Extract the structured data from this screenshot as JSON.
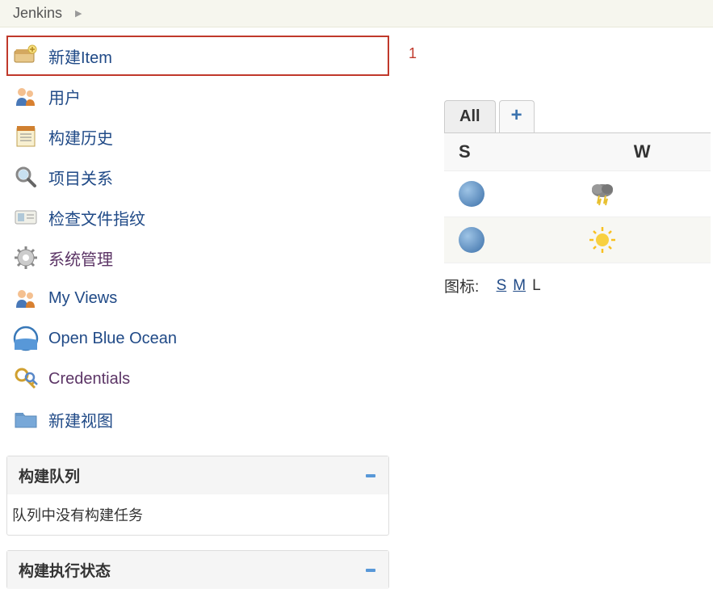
{
  "breadcrumb": {
    "root": "Jenkins"
  },
  "nav": {
    "items": [
      {
        "label": "新建Item",
        "icon": "new-item-icon"
      },
      {
        "label": "用户",
        "icon": "users-icon"
      },
      {
        "label": "构建历史",
        "icon": "history-icon"
      },
      {
        "label": "项目关系",
        "icon": "search-icon"
      },
      {
        "label": "检查文件指纹",
        "icon": "fingerprint-icon"
      },
      {
        "label": "系统管理",
        "icon": "gear-icon"
      },
      {
        "label": "My Views",
        "icon": "users-icon"
      },
      {
        "label": "Open Blue Ocean",
        "icon": "blueocean-icon"
      },
      {
        "label": "Credentials",
        "icon": "key-icon"
      },
      {
        "label": "新建视图",
        "icon": "folder-icon"
      }
    ]
  },
  "annotation": {
    "label": "1"
  },
  "queue": {
    "title": "构建队列",
    "empty_message": "队列中没有构建任务"
  },
  "executor": {
    "title": "构建执行状态"
  },
  "tabs": {
    "all": "All",
    "add": "+"
  },
  "job_table": {
    "headers": {
      "status": "S",
      "weather": "W"
    },
    "rows": [
      {
        "status": "blue",
        "weather": "storm"
      },
      {
        "status": "blue",
        "weather": "sun"
      }
    ]
  },
  "icon_size": {
    "label": "图标:",
    "small": "S",
    "medium": "M",
    "large": "L"
  }
}
